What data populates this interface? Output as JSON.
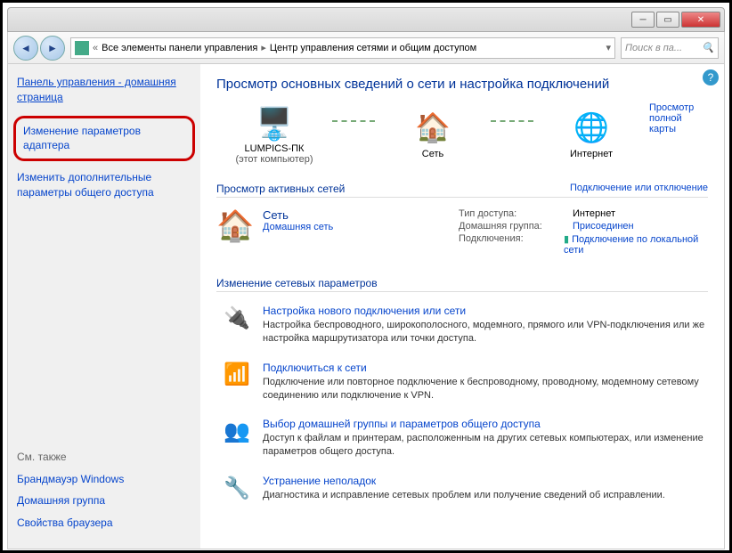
{
  "breadcrumb": {
    "root": "Все элементы панели управления",
    "current": "Центр управления сетями и общим доступом"
  },
  "search": {
    "placeholder": "Поиск в па..."
  },
  "sidebar": {
    "home": "Панель управления - домашняя страница",
    "adapter": "Изменение параметров адаптера",
    "sharing": "Изменить дополнительные параметры общего доступа",
    "seealso_hdr": "См. также",
    "seealso": [
      "Брандмауэр Windows",
      "Домашняя группа",
      "Свойства браузера"
    ]
  },
  "heading": "Просмотр основных сведений о сети и настройка подключений",
  "fullmap_link": "Просмотр полной карты",
  "netmap": {
    "pc": "LUMPICS-ПК",
    "pc_sub": "(этот компьютер)",
    "net": "Сеть",
    "inet": "Интернет"
  },
  "active_hdr": "Просмотр активных сетей",
  "active_link": "Подключение или отключение",
  "active": {
    "name": "Сеть",
    "type": "Домашняя сеть",
    "rows": {
      "access_lbl": "Тип доступа:",
      "access_val": "Интернет",
      "hg_lbl": "Домашняя группа:",
      "hg_val": "Присоединен",
      "conn_lbl": "Подключения:",
      "conn_val": "Подключение по локальной сети"
    }
  },
  "change_hdr": "Изменение сетевых параметров",
  "tasks": [
    {
      "title": "Настройка нового подключения или сети",
      "desc": "Настройка беспроводного, широкополосного, модемного, прямого или VPN-подключения или же настройка маршрутизатора или точки доступа."
    },
    {
      "title": "Подключиться к сети",
      "desc": "Подключение или повторное подключение к беспроводному, проводному, модемному сетевому соединению или подключение к VPN."
    },
    {
      "title": "Выбор домашней группы и параметров общего доступа",
      "desc": "Доступ к файлам и принтерам, расположенным на других сетевых компьютерах, или изменение параметров общего доступа."
    },
    {
      "title": "Устранение неполадок",
      "desc": "Диагностика и исправление сетевых проблем или получение сведений об исправлении."
    }
  ]
}
